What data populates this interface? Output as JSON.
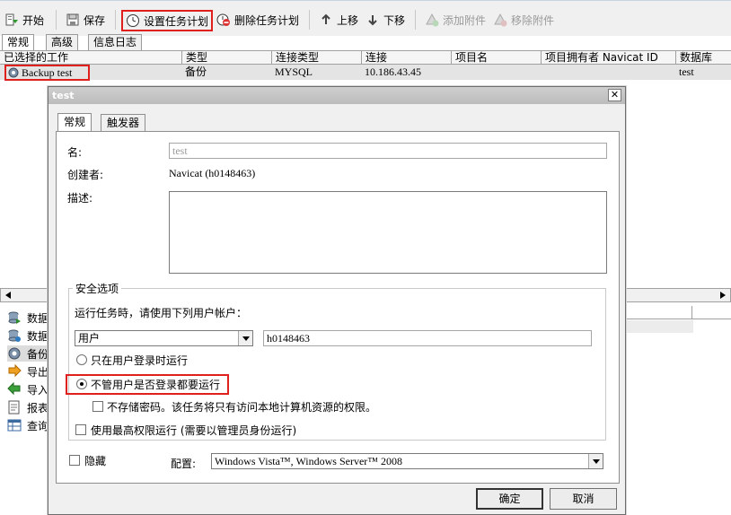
{
  "toolbar": {
    "start": "开始",
    "save": "保存",
    "set_schedule": "设置任务计划",
    "delete_schedule": "删除任务计划",
    "move_up": "上移",
    "move_down": "下移",
    "add_attachment": "添加附件",
    "remove_attachment": "移除附件"
  },
  "main_tabs": [
    "常规",
    "高级",
    "信息日志"
  ],
  "grid": {
    "columns": [
      "已选择的工作",
      "类型",
      "连接类型",
      "连接",
      "项目名",
      "项目拥有者 Navicat ID",
      "数据库"
    ],
    "row": [
      "Backup test",
      "备份",
      "MYSQL",
      "10.186.43.45",
      "",
      "",
      "test"
    ]
  },
  "side_items": [
    "数据",
    "数据",
    "备份",
    "导出",
    "导入",
    "报表",
    "查询"
  ],
  "dialog": {
    "title": "test",
    "close": "✕",
    "tabs": [
      "常规",
      "触发器"
    ],
    "name_label": "名:",
    "name_value": "test",
    "creator_label": "创建者:",
    "creator_value": "Navicat (h0148463)",
    "desc_label": "描述:",
    "security_title": "安全选项",
    "run_as_label": "运行任务時，请使用下列用户帐户：",
    "account_type": "用户",
    "account_name": "h0148463",
    "radio_logged_on": "只在用户登录时运行",
    "radio_always": "不管用户是否登录都要运行",
    "no_store_password": "不存储密码。该任务将只有访问本地计算机资源的权限。",
    "highest_priv": "使用最高权限运行 (需要以管理员身份运行)",
    "hidden_label": "隐藏",
    "config_label": "配置:",
    "config_value": "Windows Vista™, Windows Server™ 2008",
    "ok": "确定",
    "cancel": "取消"
  },
  "colors": {
    "highlight": "#e0201c",
    "row_bg": "#e4e4e4",
    "dialog_bg": "#f0f0f0"
  }
}
